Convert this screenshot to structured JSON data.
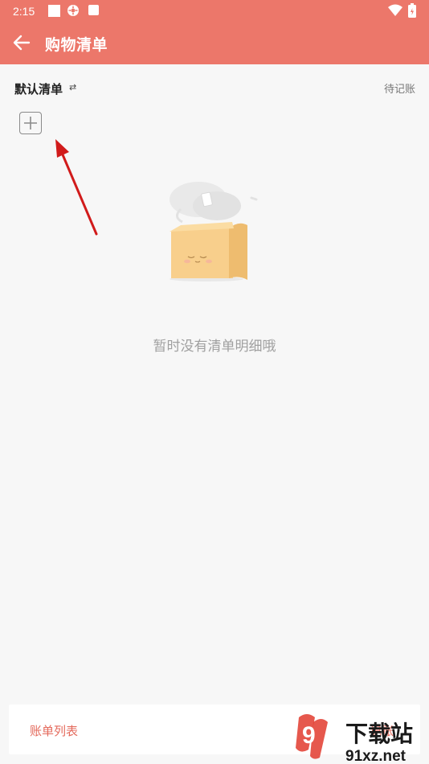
{
  "status_bar": {
    "time": "2:15"
  },
  "app_bar": {
    "title": "购物清单"
  },
  "list_header": {
    "name": "默认清单",
    "switch_symbol": "⇄",
    "pending_label": "待记账"
  },
  "empty_state": {
    "message": "暂时没有清单明细哦"
  },
  "bottom_bar": {
    "left_label": "账单列表",
    "right_label": "记账"
  },
  "watermark": {
    "big_text": "下载站",
    "url_text": "91xz.net",
    "logo_text": "9"
  },
  "colors": {
    "primary": "#ec776a",
    "accent_text": "#e46a5c",
    "background": "#f7f7f7",
    "arrow": "#d11b1b"
  }
}
